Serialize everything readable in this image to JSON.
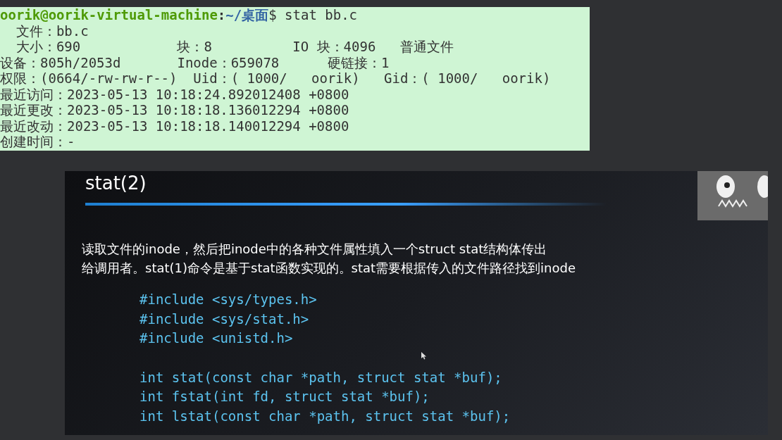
{
  "terminal": {
    "prompt": {
      "user_host": "oorik@oorik-virtual-machine",
      "separator": ":",
      "path": "~/桌面",
      "symbol": "$",
      "command": " stat bb.c"
    },
    "lines": [
      "  文件：bb.c",
      "  大小：690            块：8          IO 块：4096   普通文件",
      "设备：805h/2053d       Inode：659078      硬链接：1",
      "权限：(0664/-rw-rw-r--)  Uid：( 1000/   oorik)   Gid：( 1000/   oorik)",
      "最近访问：2023-05-13 10:18:24.892012408 +0800",
      "最近更改：2023-05-13 10:18:18.136012294 +0800",
      "最近改动：2023-05-13 10:18:18.140012294 +0800",
      "创建时间：-"
    ]
  },
  "slide": {
    "title": "stat(2)",
    "paragraph": [
      "读取文件的inode，然后把inode中的各种文件属性填入一个struct stat结构体传出",
      "给调用者。stat(1)命令是基于stat函数实现的。stat需要根据传入的文件路径找到inode"
    ],
    "includes": [
      "#include <sys/types.h>",
      "#include <sys/stat.h>",
      "#include <unistd.h>"
    ],
    "declarations": [
      "int stat(const char *path, struct stat *buf);",
      "int fstat(int fd, struct stat *buf);",
      "int lstat(const char *path, struct stat *buf);"
    ]
  }
}
